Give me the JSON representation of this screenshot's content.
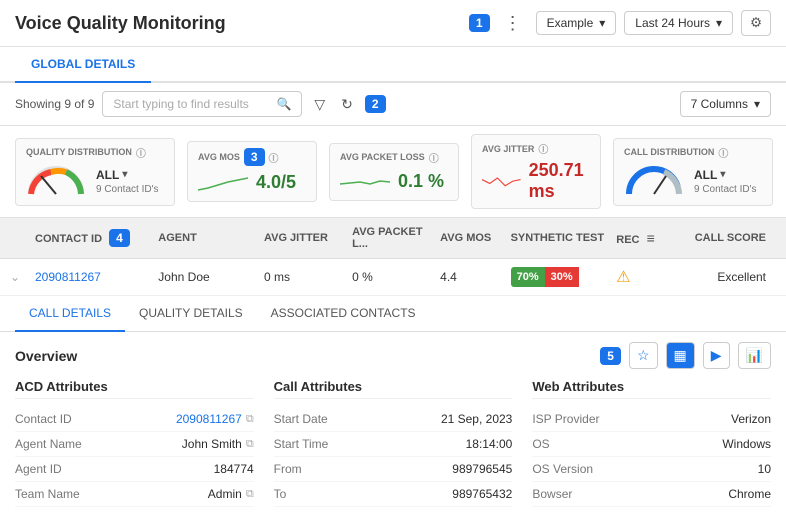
{
  "header": {
    "title": "Voice Quality Monitoring",
    "badge1": "1",
    "example_label": "Example",
    "timerange_label": "Last 24 Hours",
    "dropdown_arrow": "▾"
  },
  "global_tab": "GLOBAL DETAILS",
  "toolbar": {
    "showing": "Showing 9 of 9",
    "search_placeholder": "Start typing to find results",
    "badge2": "2",
    "columns_label": "7 Columns"
  },
  "metrics": {
    "quality_dist": {
      "label": "QUALITY DISTRIBUTION",
      "mode": "ALL",
      "sub": "9 Contact ID's"
    },
    "avg_mos": {
      "label": "AVG MOS",
      "badge": "3",
      "value": "4.0/5"
    },
    "avg_packet": {
      "label": "AVG PACKET LOSS",
      "value": "0.1 %"
    },
    "avg_jitter": {
      "label": "AVG JITTER",
      "value": "250.71 ms"
    },
    "call_dist": {
      "label": "CALL DISTRIBUTION",
      "mode": "ALL",
      "sub": "9 Contact ID's"
    }
  },
  "table": {
    "headers": {
      "contact_id": "CONTACT ID",
      "agent": "AGENT",
      "avg_jitter": "AVG JITTER",
      "avg_packet": "AVG PACKET L...",
      "avg_mos": "AVG MOS",
      "synthetic": "SYNTHETIC TEST",
      "rec": "REC",
      "score": "CALL SCORE"
    },
    "badge4": "4",
    "row": {
      "contact_id": "2090811267",
      "agent": "John Doe",
      "avg_jitter": "0 ms",
      "avg_packet": "0 %",
      "avg_mos": "4.4",
      "syn_green": "70%",
      "syn_red": "30%",
      "score": "Excellent"
    }
  },
  "detail_tabs": {
    "call_details": "CALL DETAILS",
    "quality_details": "QUALITY DETAILS",
    "associated": "ASSOCIATED CONTACTS"
  },
  "call_details": {
    "overview": "Overview",
    "badge5": "5",
    "acd": {
      "title": "ACD Attributes",
      "rows": [
        {
          "label": "Contact ID",
          "value": "2090811267",
          "link": true,
          "copy": true
        },
        {
          "label": "Agent Name",
          "value": "John Smith",
          "copy": true
        },
        {
          "label": "Agent ID",
          "value": "184774"
        },
        {
          "label": "Team Name",
          "value": "Admin",
          "copy": true
        }
      ]
    },
    "call_attr": {
      "title": "Call Attributes",
      "rows": [
        {
          "label": "Start Date",
          "value": "21 Sep, 2023"
        },
        {
          "label": "Start Time",
          "value": "18:14:00"
        },
        {
          "label": "From",
          "value": "989796545"
        },
        {
          "label": "To",
          "value": "989765432"
        }
      ]
    },
    "web_attr": {
      "title": "Web  Attributes",
      "rows": [
        {
          "label": "ISP Provider",
          "value": "Verizon"
        },
        {
          "label": "OS",
          "value": "Windows"
        },
        {
          "label": "OS Version",
          "value": "10"
        },
        {
          "label": "Bowser",
          "value": "Chrome"
        }
      ]
    }
  }
}
